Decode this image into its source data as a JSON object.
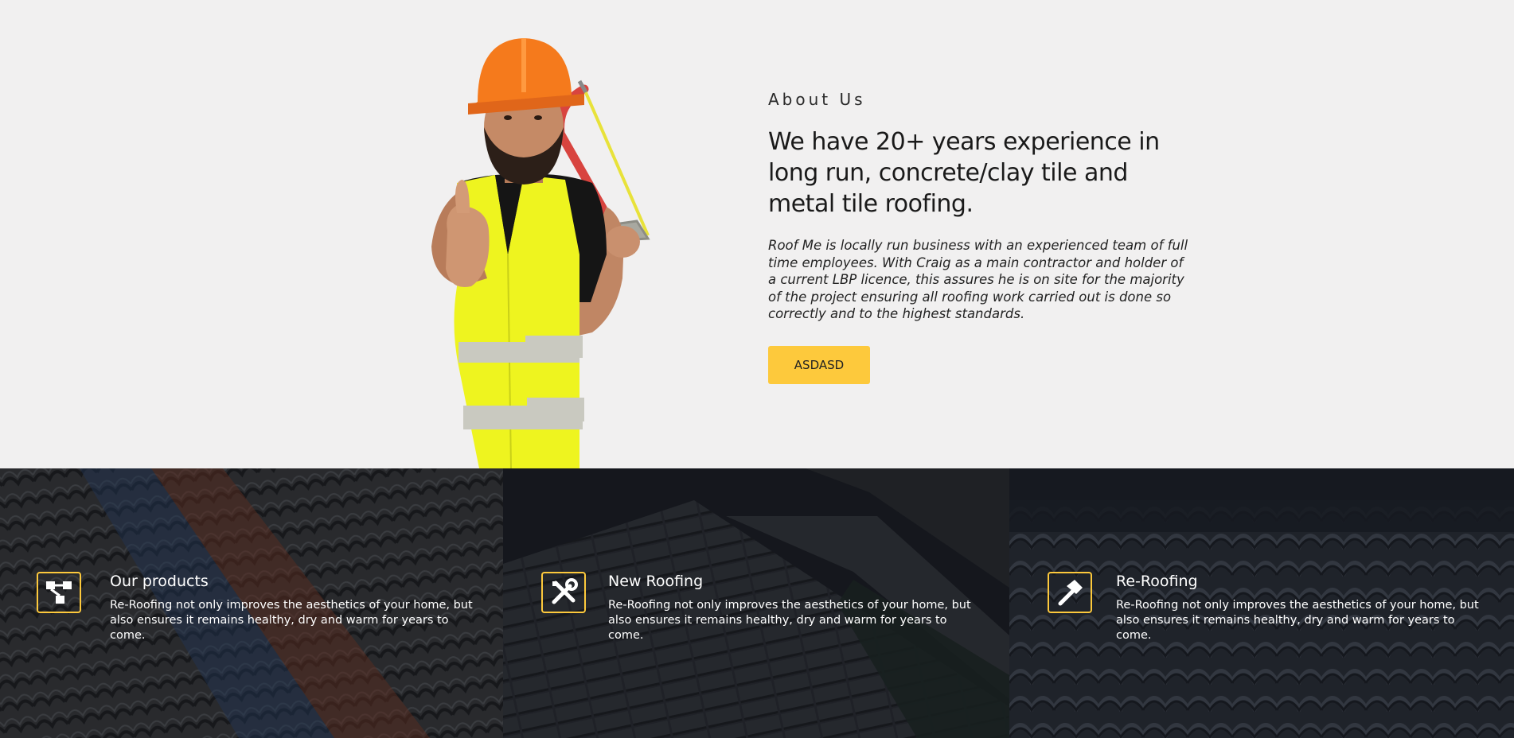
{
  "about": {
    "eyebrow": "About Us",
    "headline": "We have 20+ years experience in long run, concrete/clay tile and metal tile roofing.",
    "body": "Roof Me is locally run business with an experienced team of full time employees. With Craig as a main contractor and holder of a current LBP licence, this assures he is on site for the majority of the project ensuring all roofing work carried out is done so correctly and to the highest standards.",
    "button_label": "ASDASD"
  },
  "features": [
    {
      "icon": "sitemap-icon",
      "title": "Our products",
      "description": "Re-Roofing not only improves the aesthetics of your home, but also ensures it remains healthy, dry and warm for years to come."
    },
    {
      "icon": "tools-icon",
      "title": "New Roofing",
      "description": "Re-Roofing not only improves the aesthetics of your home, but also ensures it remains healthy, dry and warm for years to come."
    },
    {
      "icon": "hammer-icon",
      "title": "Re-Roofing",
      "description": "Re-Roofing not only improves the aesthetics of your home, but also ensures it remains healthy, dry and warm for years to come."
    }
  ],
  "colors": {
    "accent": "#fdc93c",
    "page_background": "#f1f0f0",
    "text_dark": "#1a1a1a",
    "feature_text": "#ffffff"
  }
}
